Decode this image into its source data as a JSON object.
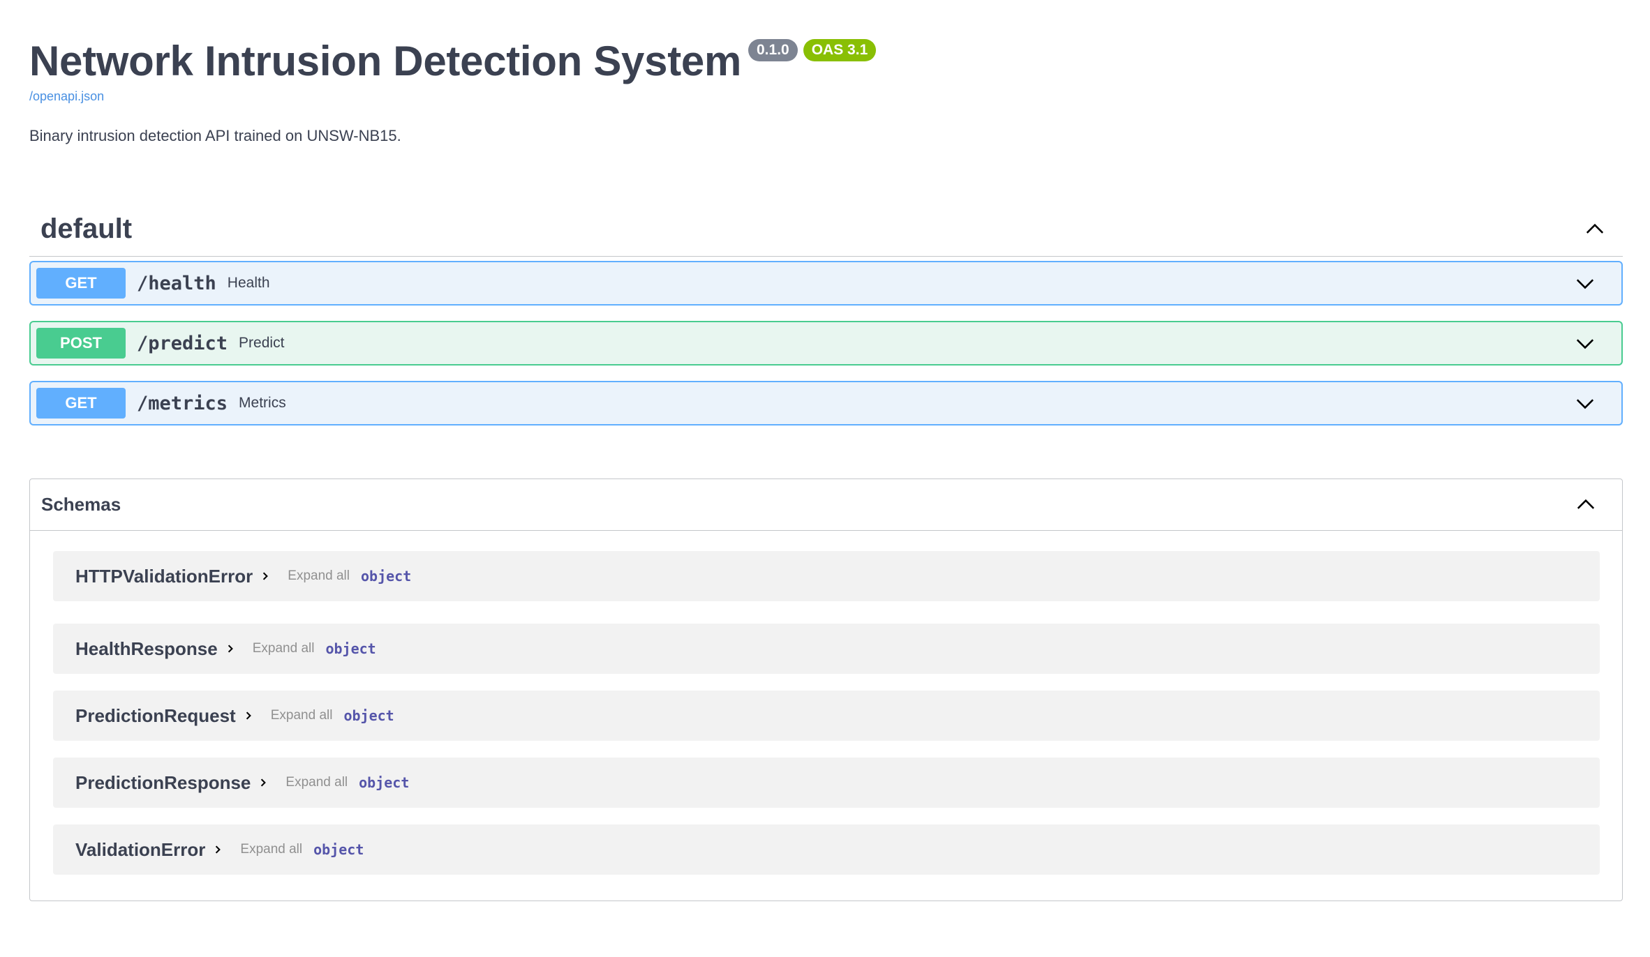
{
  "info": {
    "title": "Network Intrusion Detection System",
    "version": "0.1.0",
    "oas": "OAS 3.1",
    "spec_link": "/openapi.json",
    "description": "Binary intrusion detection API trained on UNSW-NB15."
  },
  "tag": {
    "name": "default",
    "expanded": true
  },
  "operations": [
    {
      "method": "GET",
      "path": "/health",
      "summary": "Health"
    },
    {
      "method": "POST",
      "path": "/predict",
      "summary": "Predict"
    },
    {
      "method": "GET",
      "path": "/metrics",
      "summary": "Metrics"
    }
  ],
  "schemas": {
    "title": "Schemas",
    "expand_label": "Expand all",
    "items": [
      {
        "name": "HTTPValidationError",
        "type": "object"
      },
      {
        "name": "HealthResponse",
        "type": "object"
      },
      {
        "name": "PredictionRequest",
        "type": "object"
      },
      {
        "name": "PredictionResponse",
        "type": "object"
      },
      {
        "name": "ValidationError",
        "type": "object"
      }
    ]
  },
  "colors": {
    "get": "#61affe",
    "post": "#49cc90",
    "version_badge": "#7d8492",
    "oas_badge": "#89bf04",
    "link": "#4990e2"
  },
  "icons": {
    "collapse": "chevron-up-icon",
    "expand": "chevron-down-icon",
    "model_toggle": "chevron-right-icon"
  }
}
